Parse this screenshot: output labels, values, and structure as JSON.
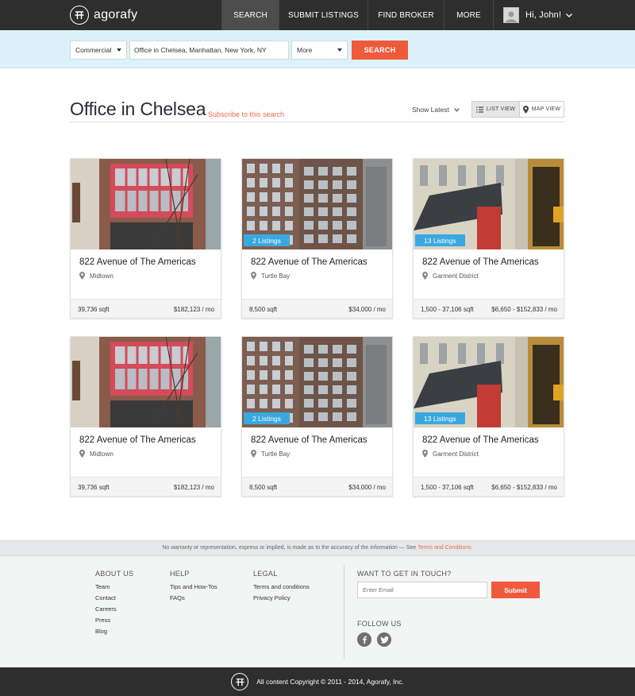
{
  "brand": {
    "name": "agorafy"
  },
  "nav": {
    "items": [
      {
        "label": "SEARCH"
      },
      {
        "label": "SUBMIT LISTINGS"
      },
      {
        "label": "FIND BROKER"
      },
      {
        "label": "MORE"
      }
    ],
    "user": {
      "greeting": "Hi, John!"
    }
  },
  "search": {
    "type_value": "Commercial",
    "location_value": "Office in Chelsea, Manhattan, New York, NY",
    "more_value": "More",
    "button_label": "SEARCH"
  },
  "results": {
    "title": "Office in Chelsea",
    "subscribe_label": "Subscribe to this search",
    "sort_label": "Show Latest",
    "list_view_label": "LIST VIEW",
    "map_view_label": "MAP VIEW"
  },
  "listings": [
    {
      "title": "822 Avenue of The Americas",
      "location": "Midtown",
      "sqft": "39,736 sqft",
      "price": "$182,123 / mo",
      "badge": "",
      "photo": "red-windows"
    },
    {
      "title": "822 Avenue of The Americas",
      "location": "Turtle Bay",
      "sqft": "8,500 sqft",
      "price": "$34,000 / mo",
      "badge": "2 Listings",
      "photo": "brick-tower"
    },
    {
      "title": "822 Avenue of The Americas",
      "location": "Garment District",
      "sqft": "1,500 - 37,106 sqft",
      "price": "$6,650 - $152,833 / mo",
      "badge": "13 Listings",
      "photo": "awning-street"
    },
    {
      "title": "822 Avenue of The Americas",
      "location": "Midtown",
      "sqft": "39,736 sqft",
      "price": "$182,123 / mo",
      "badge": "",
      "photo": "red-windows"
    },
    {
      "title": "822 Avenue of The Americas",
      "location": "Turtle Bay",
      "sqft": "8,500 sqft",
      "price": "$34,000 / mo",
      "badge": "2 Listings",
      "photo": "brick-tower"
    },
    {
      "title": "822 Avenue of The Americas",
      "location": "Garment District",
      "sqft": "1,500 - 37,106 sqft",
      "price": "$6,650 - $152,833 / mo",
      "badge": "13 Listings",
      "photo": "awning-street"
    }
  ],
  "footer": {
    "disclaimer_text": "No warranty or representation, express or implied, is made as to the accuracy of the information — See ",
    "disclaimer_link": "Terms and Conditions",
    "disclaimer_end": ".",
    "columns": [
      {
        "heading": "ABOUT US",
        "links": [
          "Team",
          "Contact",
          "Careers",
          "Press",
          "Blog"
        ]
      },
      {
        "heading": "HELP",
        "links": [
          "Tips and How-Tos",
          "FAQs"
        ]
      },
      {
        "heading": "LEGAL",
        "links": [
          "Terms and conditions",
          "Privacy Policy"
        ]
      }
    ],
    "touch_heading": "WANT TO GET IN TOUCH?",
    "email_placeholder": "Enter Email",
    "submit_label": "Submit",
    "follow_heading": "FOLLOW US",
    "social": [
      {
        "icon": "facebook-icon",
        "glyph": "f"
      },
      {
        "icon": "twitter-icon",
        "glyph": "t"
      }
    ],
    "copyright": "All content Copyright © 2011 - 2014, Agorafy, Inc."
  },
  "colors": {
    "nav_bg": "#2e2e2e",
    "accent_orange": "#ef5a3c",
    "badge_blue": "#3aa8e0",
    "searchbar_bg": "#dcf2fa"
  }
}
